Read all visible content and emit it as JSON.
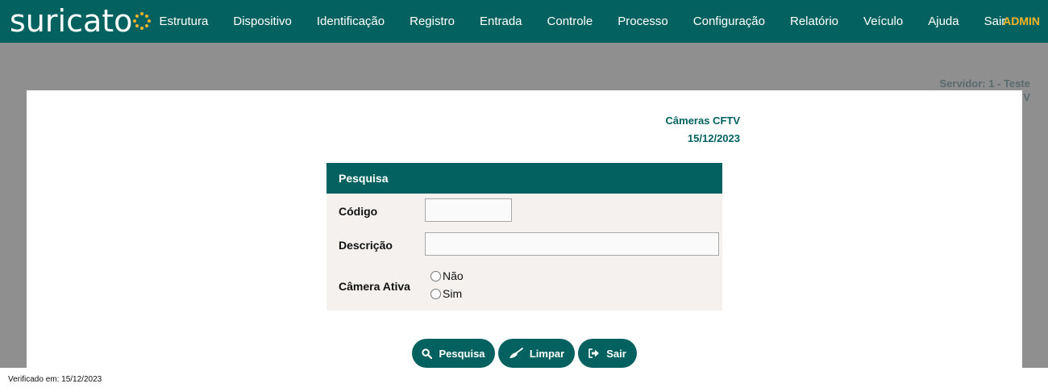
{
  "brand": {
    "name": "suricato"
  },
  "nav": {
    "items": [
      {
        "label": "Estrutura"
      },
      {
        "label": "Dispositivo"
      },
      {
        "label": "Identificação"
      },
      {
        "label": "Registro"
      },
      {
        "label": "Entrada"
      },
      {
        "label": "Controle"
      },
      {
        "label": "Processo"
      },
      {
        "label": "Configuração"
      },
      {
        "label": "Relatório"
      },
      {
        "label": "Veículo"
      },
      {
        "label": "Ajuda"
      },
      {
        "label": "Sair"
      }
    ],
    "user": "ADMIN"
  },
  "server": {
    "line1": "Servidor: 1 - Teste",
    "line2": "V"
  },
  "modal": {
    "title": "Câmeras CFTV",
    "date": "15/12/2023",
    "panel": {
      "header": "Pesquisa",
      "codigo_label": "Código",
      "codigo_value": "",
      "descricao_label": "Descrição",
      "descricao_value": "",
      "ativa_label": "Câmera Ativa",
      "options": [
        {
          "label": "Não",
          "checked": false
        },
        {
          "label": "Sim",
          "checked": false
        }
      ]
    },
    "buttons": {
      "search_label": "Pesquisa",
      "clear_label": "Limpar",
      "exit_label": "Sair"
    }
  },
  "footer": {
    "text": "Verificado em: 15/12/2023"
  },
  "colors": {
    "primary": "#03625f",
    "accent": "#f5b52a",
    "overlay": "#8f8f8f",
    "panel": "#f4f1ef"
  },
  "icons": {
    "search": "search-icon",
    "clear": "broom-icon",
    "exit": "sign-out-icon"
  }
}
